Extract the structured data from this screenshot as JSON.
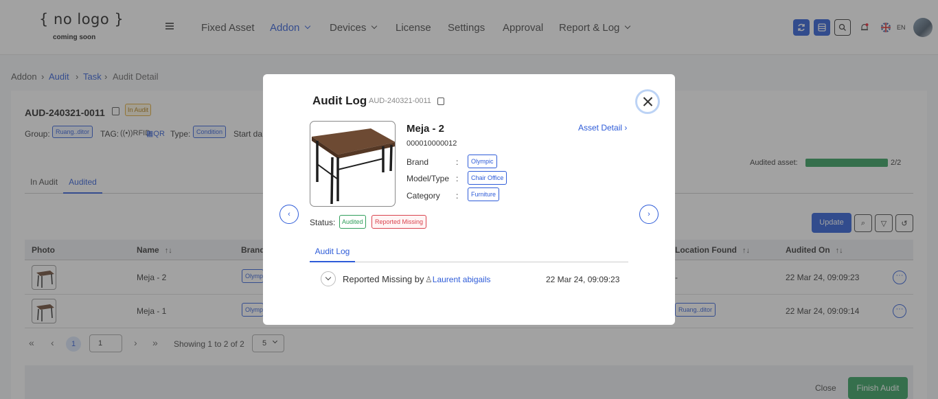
{
  "header": {
    "logo_main": "{ no logo }",
    "logo_sub": "coming soon",
    "nav": {
      "fixed_asset": "Fixed Asset",
      "addon": "Addon",
      "devices": "Devices",
      "license": "License",
      "settings": "Settings",
      "approval": "Approval",
      "report_log": "Report & Log"
    },
    "language": "EN"
  },
  "breadcrumb": {
    "addon": "Addon",
    "audit": "Audit",
    "task": "Task",
    "current": "Audit Detail"
  },
  "audit": {
    "id": "AUD-240321-0011",
    "status": "In Audit",
    "group_label": "Group:",
    "group_value": "Ruang..ditor",
    "tag_label": "TAG:",
    "tag_rfid": "RFID",
    "tag_qr": "QR",
    "type_label": "Type:",
    "type_value": "Condition",
    "start_label": "Start da",
    "audited_asset_label": "Audited asset:",
    "audited_asset_count": "2/2",
    "audited_asset_fraction": 1.0
  },
  "tabs": {
    "in_audit": "In Audit",
    "audited": "Audited"
  },
  "toolbar": {
    "update": "Update"
  },
  "table": {
    "headers": {
      "photo": "Photo",
      "name": "Name",
      "brand": "Brand",
      "location_found": "Location Found",
      "audited_on": "Audited On"
    },
    "rows": [
      {
        "name": "Meja - 2",
        "brand": "Olymp",
        "location_found": "-",
        "audited_on": "22 Mar 24, 09:09:23"
      },
      {
        "name": "Meja - 1",
        "brand": "Olymp",
        "location_found": "Ruang..ditor",
        "audited_on": "22 Mar 24, 09:09:14"
      }
    ]
  },
  "pagination": {
    "current_page": "1",
    "page_input": "1",
    "showing": "Showing 1 to 2 of 2",
    "page_size": "5"
  },
  "footer": {
    "close": "Close",
    "finish_audit": "Finish Audit"
  },
  "modal": {
    "title": "Audit Log",
    "audit_id": "AUD-240321-0011",
    "asset_name": "Meja - 2",
    "asset_code": "000010000012",
    "asset_detail_link": "Asset Detail",
    "brand_label": "Brand",
    "brand_value": "Olympic",
    "model_label": "Model/Type",
    "model_value": "Chair Office",
    "category_label": "Category",
    "category_value": "Furniture",
    "colon": ":",
    "status_label": "Status:",
    "status_audited": "Audited",
    "status_missing": "Reported Missing",
    "tab_audit_log": "Audit Log",
    "log": {
      "action": "Reported Missing by",
      "user": "Laurent abigails",
      "time": "22 Mar 24, 09:09:23"
    }
  },
  "colors": {
    "primary": "#2a5bd7",
    "success": "#2f9e5a",
    "danger": "#d9414c",
    "warning": "#e0a82e"
  }
}
